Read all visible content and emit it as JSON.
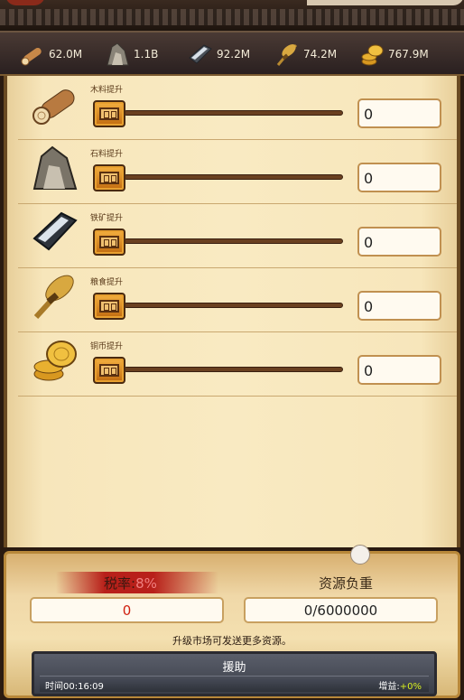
{
  "resources": [
    {
      "icon": "wood-icon",
      "value": "62.0M"
    },
    {
      "icon": "stone-icon",
      "value": "1.1B"
    },
    {
      "icon": "iron-icon",
      "value": "92.2M"
    },
    {
      "icon": "grain-icon",
      "value": "74.2M"
    },
    {
      "icon": "coin-icon",
      "value": "767.9M"
    }
  ],
  "rows": [
    {
      "icon": "wood-icon",
      "label": "木料提升",
      "value": "0"
    },
    {
      "icon": "stone-icon",
      "label": "石料提升",
      "value": "0"
    },
    {
      "icon": "iron-icon",
      "label": "铁矿提升",
      "value": "0"
    },
    {
      "icon": "grain-icon",
      "label": "粮食提升",
      "value": "0"
    },
    {
      "icon": "coin-icon",
      "label": "铜币提升",
      "value": "0"
    }
  ],
  "bottom": {
    "tax_label": "税率:",
    "tax_pct": "8%",
    "load_label": "资源负重",
    "tax_value": "0",
    "load_value": "0/6000000",
    "hint": "升级市场可发送更多资源。",
    "aid_title": "援助",
    "aid_time": "时间00:16:09",
    "aid_gain_label": "增益:",
    "aid_gain_value": "+0%"
  },
  "colors": {
    "parchment": "#f9eac2",
    "slider_handle": "#f4b040",
    "tax_red": "#b8201a",
    "gain_green": "#d8f020"
  }
}
